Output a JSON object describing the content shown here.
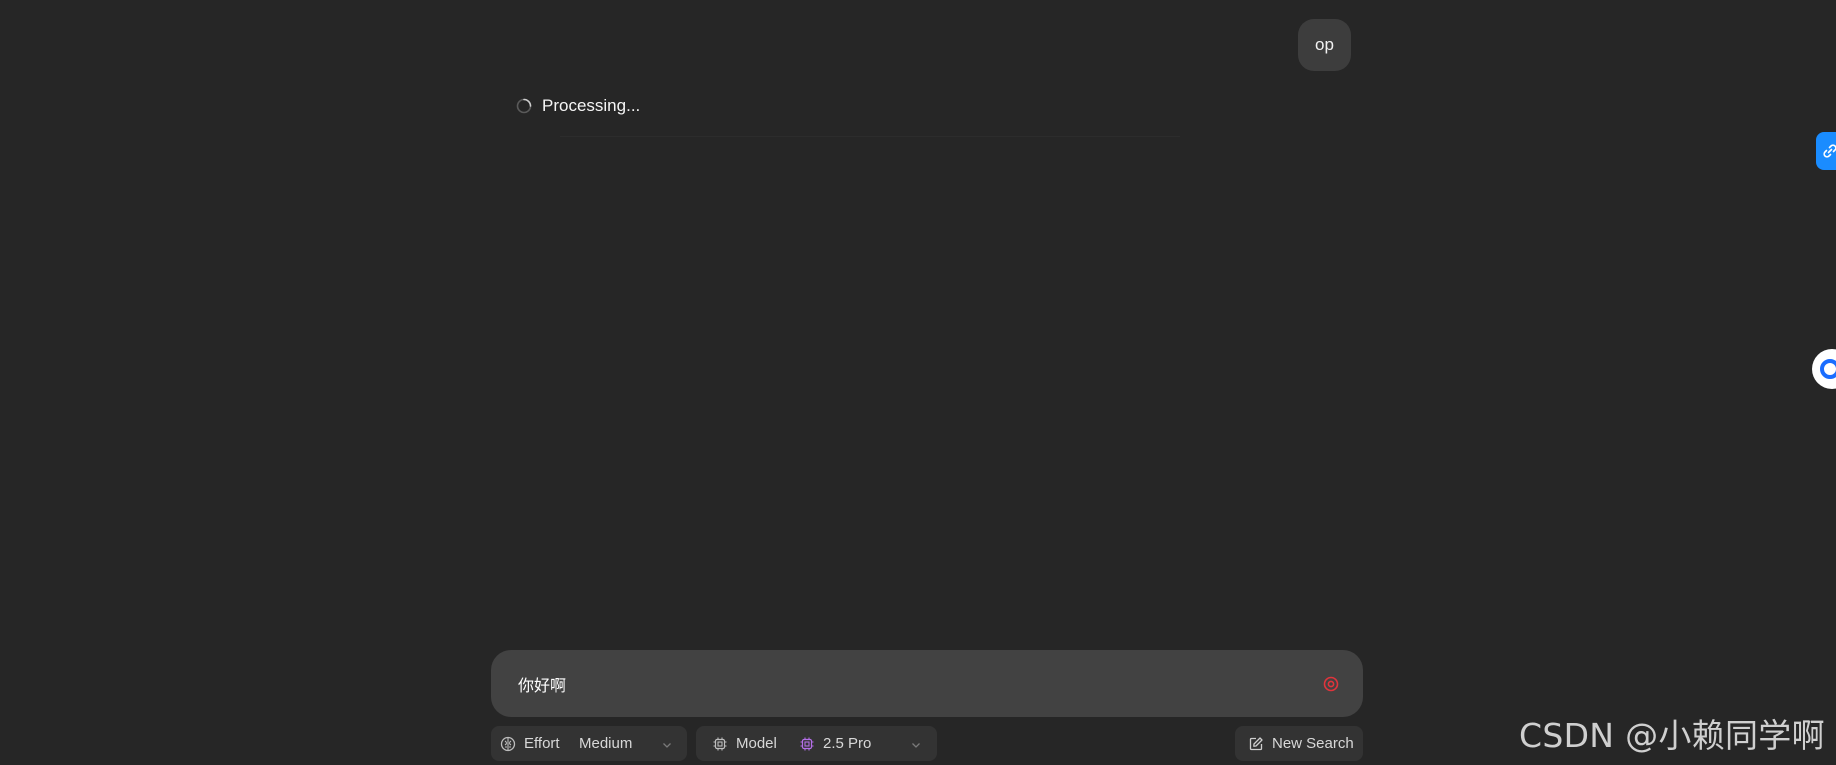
{
  "chat": {
    "user_message": "op",
    "status_text": "Processing..."
  },
  "composer": {
    "input_value": "你好啊"
  },
  "controls": {
    "effort_label": "Effort",
    "effort_value": "Medium",
    "model_label": "Model",
    "model_value": "2.5 Pro",
    "new_search_label": "New Search"
  },
  "colors": {
    "background": "#262626",
    "composer": "#424242",
    "stop_icon": "#e0343c",
    "model_icon": "#b46fe8",
    "float_link": "#1a8cff"
  },
  "icons": {
    "status": "spinner-icon",
    "stop": "stop-circle-icon",
    "effort": "brain-icon",
    "model_label": "cpu-icon",
    "model_value": "cpu-purple-icon",
    "dropdown": "chevron-down-icon",
    "new_search": "edit-icon",
    "float_link": "link-icon",
    "float_circle": "ring-icon"
  },
  "watermark": "CSDN @小赖同学啊"
}
